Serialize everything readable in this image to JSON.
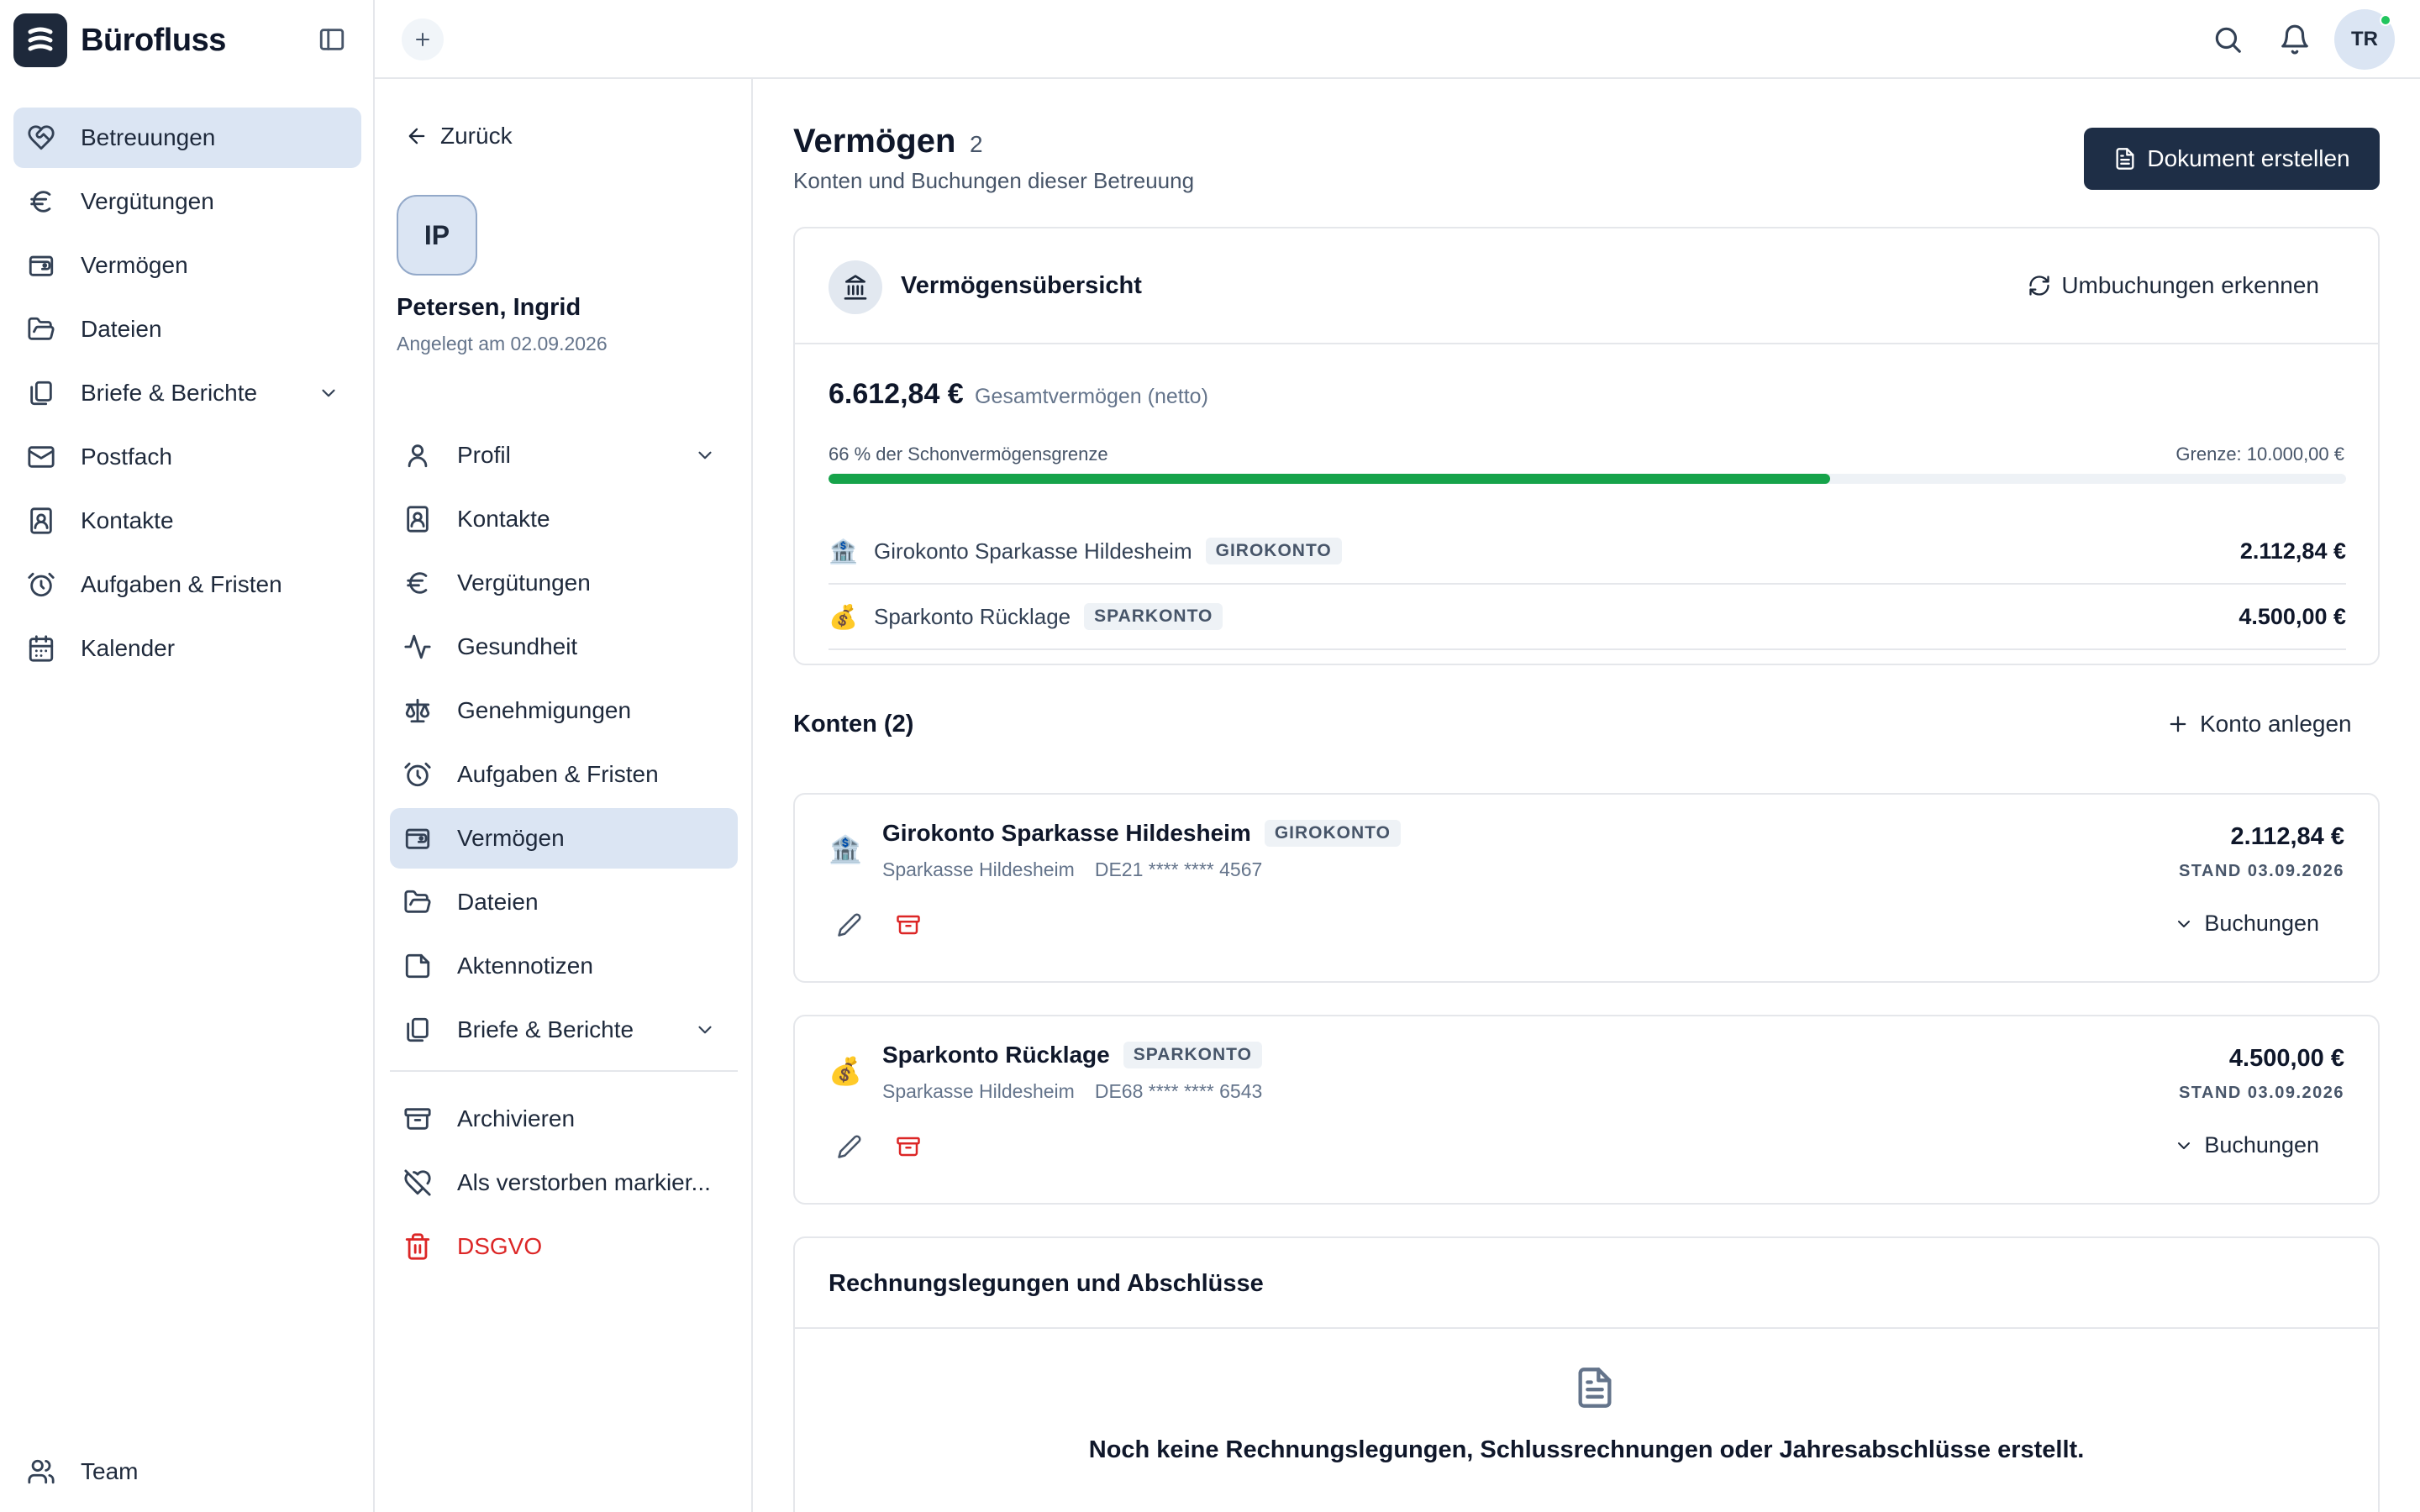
{
  "app": {
    "name": "Bürofluss"
  },
  "sidebar": {
    "items": [
      {
        "label": "Betreuungen",
        "icon": "heart-handshake-icon",
        "active": true
      },
      {
        "label": "Vergütungen",
        "icon": "euro-icon"
      },
      {
        "label": "Vermögen",
        "icon": "wallet-icon"
      },
      {
        "label": "Dateien",
        "icon": "folder-open-icon"
      },
      {
        "label": "Briefe & Berichte",
        "icon": "files-icon",
        "expandable": true
      },
      {
        "label": "Postfach",
        "icon": "mail-icon"
      },
      {
        "label": "Kontakte",
        "icon": "contact-book-icon"
      },
      {
        "label": "Aufgaben & Fristen",
        "icon": "alarm-clock-icon"
      },
      {
        "label": "Kalender",
        "icon": "calendar-icon"
      }
    ],
    "team_label": "Team"
  },
  "topbar": {
    "user_initials": "TR",
    "presence_color": "#22c55e"
  },
  "case": {
    "back_label": "Zurück",
    "initials": "IP",
    "name": "Petersen, Ingrid",
    "created": "Angelegt am 02.09.2026",
    "nav": [
      {
        "label": "Profil",
        "icon": "user-icon",
        "expandable": true
      },
      {
        "label": "Kontakte",
        "icon": "contact-book-icon"
      },
      {
        "label": "Vergütungen",
        "icon": "euro-icon"
      },
      {
        "label": "Gesundheit",
        "icon": "activity-icon"
      },
      {
        "label": "Genehmigungen",
        "icon": "scale-icon"
      },
      {
        "label": "Aufgaben & Fristen",
        "icon": "alarm-clock-icon"
      },
      {
        "label": "Vermögen",
        "icon": "wallet-icon",
        "active": true
      },
      {
        "label": "Dateien",
        "icon": "folder-open-icon"
      },
      {
        "label": "Aktennotizen",
        "icon": "sticky-note-icon"
      },
      {
        "label": "Briefe & Berichte",
        "icon": "files-icon",
        "expandable": true
      }
    ],
    "actions": [
      {
        "label": "Archivieren",
        "icon": "archive-icon"
      },
      {
        "label": "Als verstorben markier...",
        "icon": "heart-off-icon"
      },
      {
        "label": "DSGVO",
        "icon": "trash-icon",
        "danger": true
      }
    ]
  },
  "main": {
    "title": "Vermögen",
    "count": "2",
    "subtitle": "Konten und Buchungen dieser Betreuung",
    "create_document_label": "Dokument erstellen",
    "overview": {
      "title": "Vermögensübersicht",
      "detect_label": "Umbuchungen erkennen",
      "total": "6.612,84 €",
      "total_label": "Gesamtvermögen (netto)",
      "progress_label": "66 % der Schonvermögensgrenze",
      "progress_percent": 66,
      "limit_label": "Grenze: 10.000,00 €",
      "accent_color": "#16a34a",
      "rows": [
        {
          "emoji": "🏦",
          "name": "Girokonto Sparkasse Hildesheim",
          "badge": "GIROKONTO",
          "amount": "2.112,84 €"
        },
        {
          "emoji": "💰",
          "name": "Sparkonto Rücklage",
          "badge": "SPARKONTO",
          "amount": "4.500,00 €"
        }
      ]
    },
    "accounts_title": "Konten (2)",
    "add_account_label": "Konto anlegen",
    "accounts": [
      {
        "emoji": "🏦",
        "name": "Girokonto Sparkasse Hildesheim",
        "badge": "GIROKONTO",
        "bank": "Sparkasse Hildesheim",
        "iban": "DE21 **** **** 4567",
        "amount": "2.112,84 €",
        "stand": "STAND 03.09.2026",
        "toggle_label": "Buchungen"
      },
      {
        "emoji": "💰",
        "name": "Sparkonto Rücklage",
        "badge": "SPARKONTO",
        "bank": "Sparkasse Hildesheim",
        "iban": "DE68 **** **** 6543",
        "amount": "4.500,00 €",
        "stand": "STAND 03.09.2026",
        "toggle_label": "Buchungen"
      }
    ],
    "reports": {
      "title": "Rechnungslegungen und Abschlüsse",
      "empty": "Noch keine Rechnungslegungen, Schlussrechnungen oder Jahresabschlüsse erstellt."
    }
  }
}
